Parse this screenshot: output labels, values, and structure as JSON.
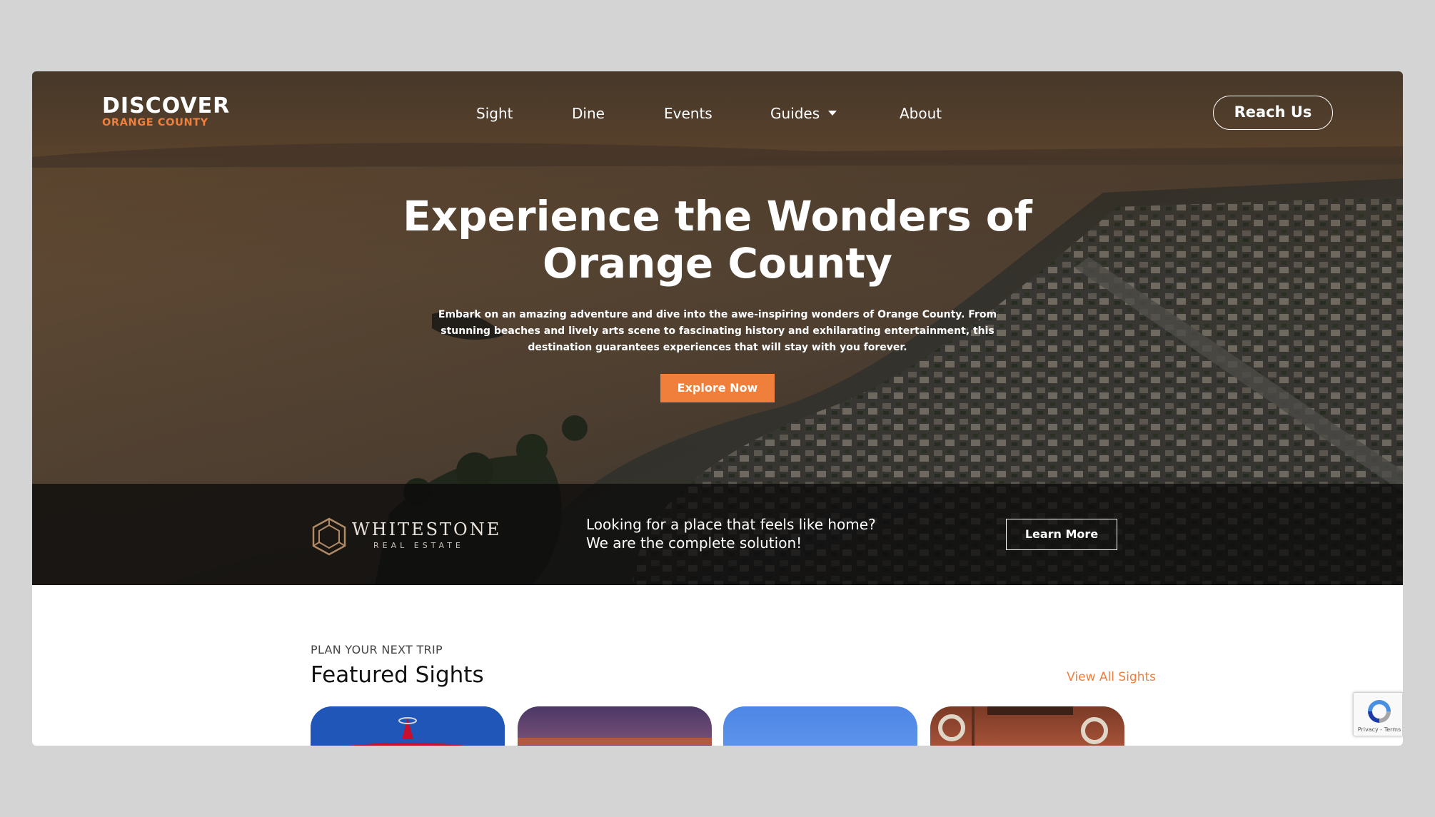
{
  "brand": {
    "line1": "DISCOVER",
    "line2": "ORANGE COUNTY",
    "accent_color": "#f07f3c"
  },
  "nav": {
    "items": [
      {
        "label": "Sight"
      },
      {
        "label": "Dine"
      },
      {
        "label": "Events"
      },
      {
        "label": "Guides"
      },
      {
        "label": "About"
      }
    ],
    "cta_label": "Reach Us"
  },
  "hero": {
    "title": "Experience the Wonders of Orange County",
    "subtitle": "Embark on an amazing adventure and dive into the awe-inspiring wonders of Orange County. From stunning beaches and lively arts scene to fascinating history and exhilarating entertainment, this destination guarantees experiences that will stay with you forever.",
    "button_label": "Explore Now"
  },
  "ad": {
    "brand_name": "WHITESTONE",
    "brand_tagline": "REAL ESTATE",
    "line1": "Looking for a place that feels like home?",
    "line2": "We are the complete solution!",
    "button_label": "Learn More"
  },
  "featured": {
    "eyebrow": "PLAN YOUR NEXT TRIP",
    "title": "Featured Sights",
    "view_all_label": "View All Sights"
  },
  "recaptcha": {
    "links": "Privacy - Terms"
  }
}
